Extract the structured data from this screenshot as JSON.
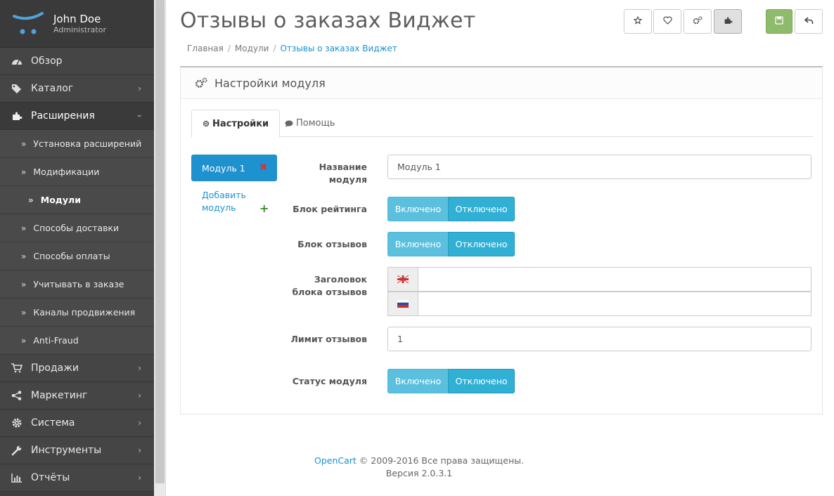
{
  "profile": {
    "name": "John Doe",
    "role": "Administrator"
  },
  "menu": {
    "overview": "Обзор",
    "catalog": "Каталог",
    "extensions": "Расширения",
    "sub": [
      "Установка расширений",
      "Модификации",
      "Модули",
      "Способы доставки",
      "Способы оплаты",
      "Учитывать в заказе",
      "Каналы продвижения",
      "Anti-Fraud"
    ],
    "sales": "Продажи",
    "marketing": "Маркетинг",
    "system": "Система",
    "tools": "Инструменты",
    "reports": "Отчёты"
  },
  "page": {
    "title": "Отзывы о заказах Виджет",
    "breadcrumb": [
      "Главная",
      "Модули",
      "Отзывы о заказах Виджет"
    ]
  },
  "panel": {
    "heading": "Настройки модуля",
    "tabs": [
      "Настройки",
      "Помощь"
    ],
    "module_pill": "Модуль 1",
    "add_module": "Добавить модуль",
    "fields": {
      "name_label": "Название модуля",
      "name_value": "Модуль 1",
      "rating_label": "Блок рейтинга",
      "reviews_label": "Блок отзывов",
      "header_label": "Заголовок блока отзывов",
      "limit_label": "Лимит отзывов",
      "limit_value": "1",
      "status_label": "Статус модуля"
    },
    "toggle_on": "Включено",
    "toggle_off": "Отключено"
  },
  "footer": {
    "link": "OpenCart",
    "copyright": " © 2009-2016 Все права защищены.",
    "version": "Версия 2.0.3.1"
  },
  "colors": {
    "primary": "#1e91cf",
    "toggle_on": "#5bc0de",
    "toggle_off": "#31b0d5",
    "save": "#8fbb6c",
    "sidebar": "#3f3f3f"
  }
}
